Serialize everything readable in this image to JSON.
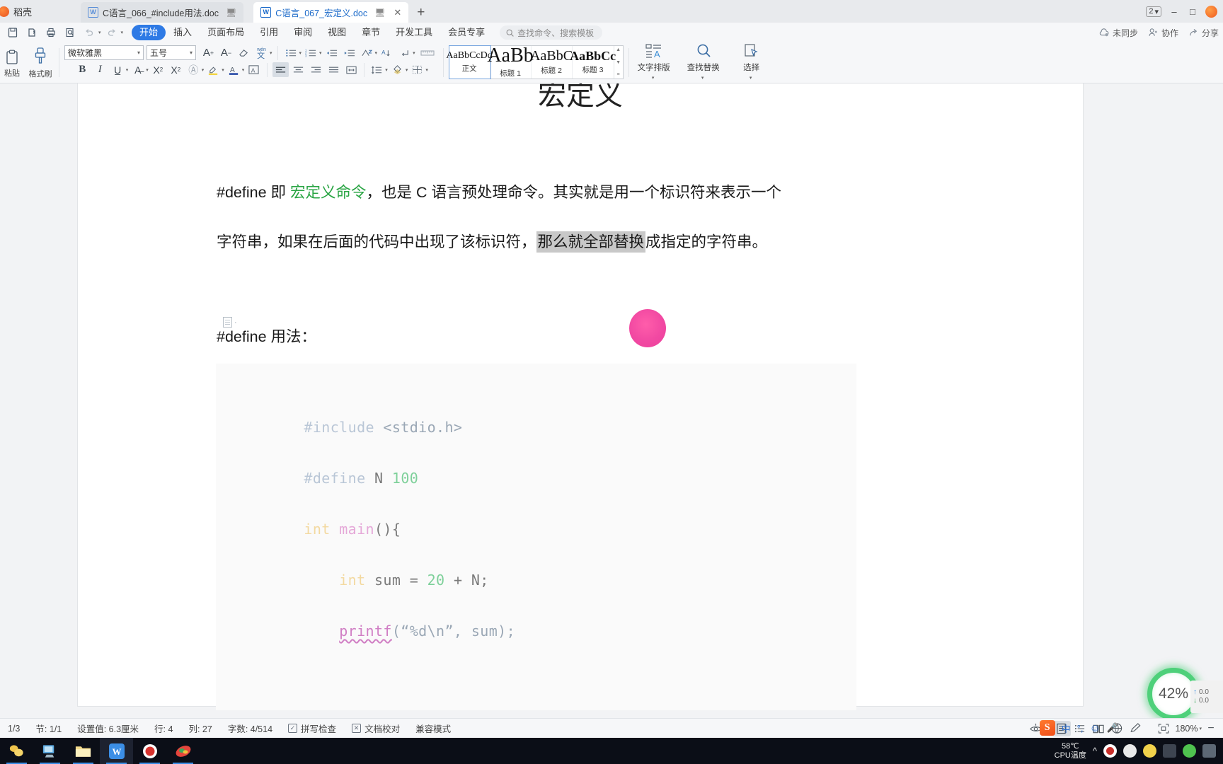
{
  "window": {
    "app_name": "稻壳",
    "tabs": [
      {
        "title": "C语言_066_#include用法.doc",
        "active": false,
        "icon": "wps-writer-icon"
      },
      {
        "title": "C语言_067_宏定义.doc",
        "active": true,
        "icon": "wps-writer-icon"
      }
    ],
    "new_tab_label": "+",
    "badge_count": "2",
    "window_controls": [
      "minimize",
      "maximize",
      "close"
    ]
  },
  "menubar": {
    "quick_access": [
      "save-icon",
      "print-preview-icon",
      "print-icon",
      "find-icon",
      "undo-icon",
      "redo-icon",
      "customize-icon"
    ],
    "items": [
      {
        "label": "开始",
        "active": true
      },
      {
        "label": "插入",
        "active": false
      },
      {
        "label": "页面布局",
        "active": false
      },
      {
        "label": "引用",
        "active": false
      },
      {
        "label": "审阅",
        "active": false
      },
      {
        "label": "视图",
        "active": false
      },
      {
        "label": "章节",
        "active": false
      },
      {
        "label": "开发工具",
        "active": false
      },
      {
        "label": "会员专享",
        "active": false
      }
    ],
    "search_placeholder": "查找命令、搜索模板",
    "right_items": [
      {
        "label": "未同步",
        "icon": "cloud-sync-icon"
      },
      {
        "label": "协作",
        "icon": "collaborate-icon"
      },
      {
        "label": "分享",
        "icon": "share-icon"
      }
    ]
  },
  "ribbon": {
    "paste_label": "粘贴",
    "format_painter_label": "格式刷",
    "font_family": "微软雅黑",
    "font_size": "五号",
    "font_buttons": [
      "grow-font-icon",
      "shrink-font-icon",
      "clear-format-icon",
      "pinyin-guide-icon"
    ],
    "style_buttons": [
      "bold-icon",
      "italic-icon",
      "underline-icon",
      "strikethrough-icon",
      "superscript-icon",
      "subscript-icon",
      "text-effects-icon",
      "highlight-color-icon",
      "font-color-icon",
      "character-border-icon"
    ],
    "paragraph_buttons": [
      "bullet-list-icon",
      "numbered-list-icon",
      "decrease-indent-icon",
      "increase-indent-icon",
      "sort-icon",
      "multilevel-list-icon",
      "show-marks-icon",
      "ruler-icon",
      "align-left-icon",
      "align-center-icon",
      "align-right-icon",
      "justify-icon",
      "distribute-icon",
      "line-spacing-icon",
      "shading-icon",
      "borders-icon"
    ],
    "styles": [
      {
        "preview": "AaBbCcDd",
        "name": "正文",
        "size": 14,
        "bold": false,
        "selected": true
      },
      {
        "preview": "AaBb",
        "name": "标题 1",
        "size": 30,
        "bold": false,
        "selected": false
      },
      {
        "preview": "AaBbC",
        "name": "标题 2",
        "size": 22,
        "bold": false,
        "selected": false
      },
      {
        "preview": "AaBbCc",
        "name": "标题 3",
        "size": 19,
        "bold": true,
        "selected": false
      }
    ],
    "typography_label": "文字排版",
    "find_replace_label": "查找替换",
    "select_label": "选择"
  },
  "document": {
    "title": "宏定义",
    "paragraphs": [
      {
        "id": "p1",
        "runs": [
          {
            "text": "#define 即 ",
            "style": "normal"
          },
          {
            "text": "宏定义命令",
            "style": "green"
          },
          {
            "text": "，也是 C 语言预处理命令。其实就是用一个标识符来表示一个",
            "style": "normal"
          }
        ]
      },
      {
        "id": "p2",
        "runs": [
          {
            "text": "字符串，如果在后面的代码中出现了该标识符，",
            "style": "normal"
          },
          {
            "text": "那么就全部替换",
            "style": "highlight-gray"
          },
          {
            "text": "成指定的字符串。",
            "style": "normal"
          }
        ]
      },
      {
        "id": "p3",
        "runs": [
          {
            "text": "#define 用法：",
            "style": "normal"
          }
        ]
      }
    ],
    "code_lines": [
      {
        "tokens": [
          {
            "t": "#include",
            "c": "pre"
          },
          {
            "t": " ",
            "c": "pl"
          },
          {
            "t": "<stdio.h>",
            "c": "inc"
          }
        ]
      },
      {
        "tokens": [
          {
            "t": "#define",
            "c": "pre"
          },
          {
            "t": " ",
            "c": "pl"
          },
          {
            "t": "N",
            "c": "pl"
          },
          {
            "t": " ",
            "c": "pl"
          },
          {
            "t": "100",
            "c": "num"
          }
        ]
      },
      {
        "tokens": [
          {
            "t": "int",
            "c": "kw"
          },
          {
            "t": " ",
            "c": "pl"
          },
          {
            "t": "main",
            "c": "fn"
          },
          {
            "t": "(){",
            "c": "pl"
          }
        ]
      },
      {
        "tokens": [
          {
            "t": "    ",
            "c": "pl"
          },
          {
            "t": "int",
            "c": "kw"
          },
          {
            "t": " sum = ",
            "c": "pl"
          },
          {
            "t": "20",
            "c": "num"
          },
          {
            "t": " + N;",
            "c": "pl"
          }
        ]
      },
      {
        "tokens": [
          {
            "t": "    ",
            "c": "pl"
          },
          {
            "t": "printf",
            "c": "printf"
          },
          {
            "t": "(“%d\\n”, sum);",
            "c": "str"
          }
        ]
      }
    ]
  },
  "overlays": {
    "zoom_percent": "42%",
    "net_up": "0.0",
    "net_down": "0.0"
  },
  "statusbar": {
    "page": "1/3",
    "section": "节: 1/1",
    "setting_value": "设置值: 6.3厘米",
    "row": "行: 4",
    "column": "列: 27",
    "word_count": "字数: 4/514",
    "spell_check": "拼写检查",
    "doc_proof": "文档校对",
    "compat_mode": "兼容模式",
    "view_buttons": [
      "read-mode-icon",
      "page-view-icon",
      "outline-view-icon",
      "web-layout-icon",
      "edit-mode-icon"
    ],
    "eye_icon": "eye-protect-icon",
    "fit_icon": "fit-page-icon",
    "zoom_level": "180%",
    "zoom_out": "−"
  },
  "taskbar": {
    "apps": [
      {
        "icon": "wechat-files-icon",
        "active": false
      },
      {
        "icon": "computer-icon",
        "active": false
      },
      {
        "icon": "file-explorer-icon",
        "active": false
      },
      {
        "icon": "wps-office-icon",
        "active": true
      },
      {
        "icon": "recorder-icon",
        "active": false
      },
      {
        "icon": "colorful-app-icon",
        "active": false
      }
    ],
    "tray": {
      "cpu_temp": "58℃",
      "cpu_label": "CPU温度",
      "expand_icon": "chevron-up-icon",
      "icons": [
        "record-icon",
        "face-icon",
        "shield-icon",
        "battery-icon",
        "wechat-icon",
        "network-icon"
      ]
    },
    "ime": {
      "logo": "S",
      "lang": "中",
      "punct": "°,",
      "emoji": "☺",
      "mic": "🎤"
    }
  }
}
